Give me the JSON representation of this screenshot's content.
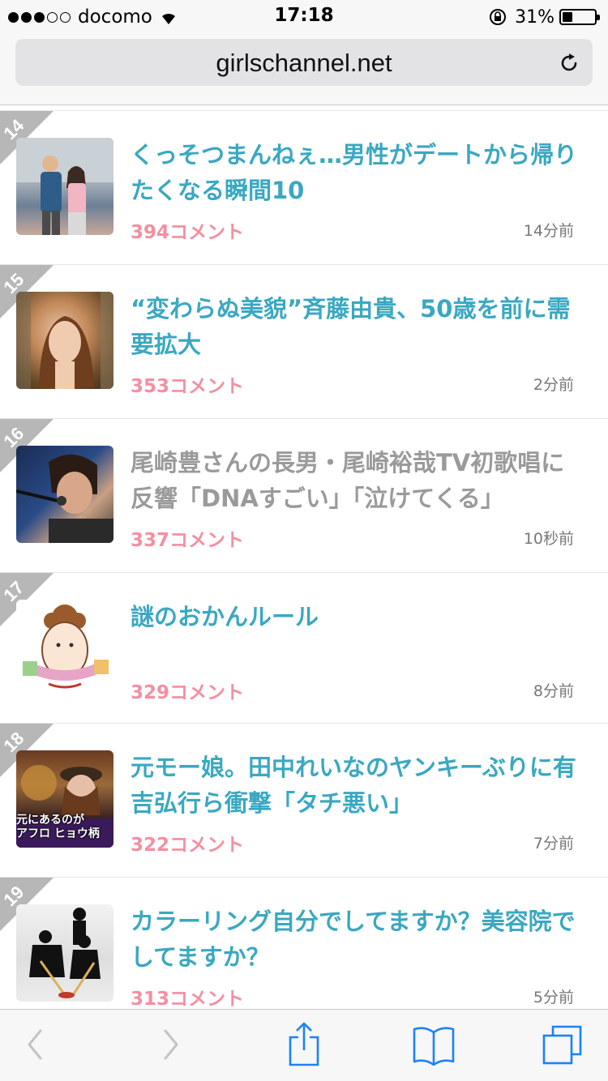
{
  "status_bar": {
    "carrier": "docomo",
    "time": "17:18",
    "battery": "31%",
    "signal_dots_filled": 3,
    "signal_dots_total": 5
  },
  "address_bar": {
    "url": "girlschannel.net"
  },
  "items": [
    {
      "rank": "14",
      "title": "くっそつまんねぇ…男性がデートから帰りたくなる瞬間10",
      "comments": "394コメント",
      "time": "14分前",
      "visited": false
    },
    {
      "rank": "15",
      "title": "“変わらぬ美貌”斉藤由貴、50歳を前に需要拡大",
      "comments": "353コメント",
      "time": "2分前",
      "visited": false
    },
    {
      "rank": "16",
      "title": "尾崎豊さんの長男・尾崎裕哉TV初歌唱に反響「DNAすごい」「泣けてくる」",
      "comments": "337コメント",
      "time": "10秒前",
      "visited": true
    },
    {
      "rank": "17",
      "title": "謎のおかんルール",
      "comments": "329コメント",
      "time": "8分前",
      "visited": false
    },
    {
      "rank": "18",
      "title": "元モー娘。田中れいなのヤンキーぶりに有吉弘行ら衝撃「タチ悪い」",
      "comments": "322コメント",
      "time": "7分前",
      "visited": false
    },
    {
      "rank": "19",
      "title": "カラーリング自分でしてますか？美容院でしてますか？",
      "comments": "313コメント",
      "time": "5分前",
      "visited": false
    }
  ],
  "thumb_captions": {
    "item18": "元にあるのが\nアフロ ヒョウ柄"
  },
  "toolbar": {
    "icons": [
      "back-icon",
      "forward-icon",
      "share-icon",
      "bookmarks-icon",
      "tabs-icon"
    ]
  },
  "colors": {
    "title": "#3aa8c1",
    "title_visited": "#9a9a9a",
    "comments": "#f48fa0",
    "rank_badge": "#b7b7b7",
    "toolbar_icon": "#1a82fb"
  }
}
